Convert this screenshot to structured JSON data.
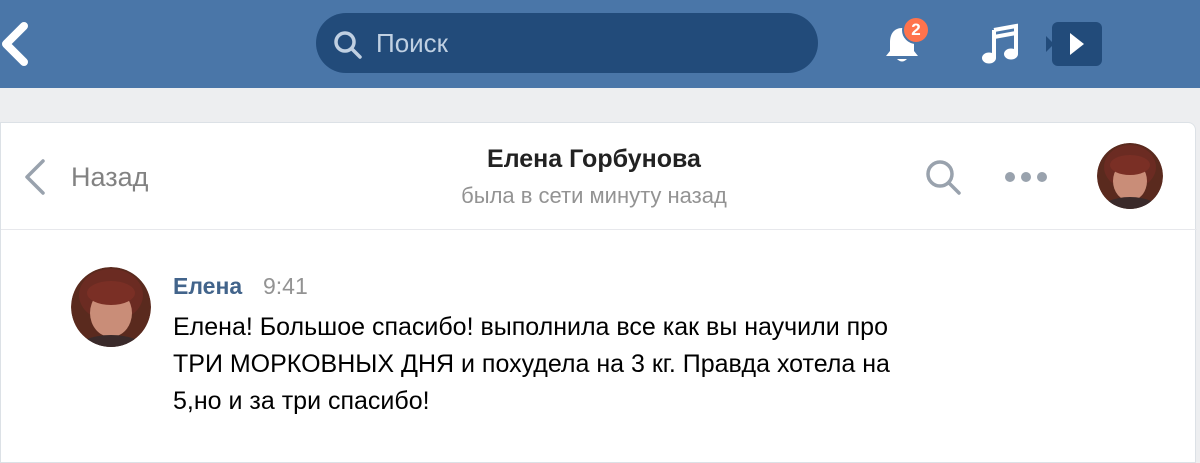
{
  "topbar": {
    "search_placeholder": "Поиск",
    "notifications_count": "2",
    "icons": [
      "vk-back-chevron-icon",
      "search-icon",
      "bell-icon",
      "music-note-icon",
      "video-player-icon"
    ]
  },
  "conversation": {
    "back_label": "Назад",
    "peer_name": "Елена Горбунова",
    "peer_status": "была в сети минуту назад"
  },
  "messages": [
    {
      "author": "Елена",
      "time": "9:41",
      "lines": [
        "Елена! Большое спасибо! выполнила все как вы научили про",
        "ТРИ МОРКОВНЫХ ДНЯ и похудела на 3 кг. Правда хотела на",
        "5,но и за три спасибо!"
      ]
    }
  ],
  "colors": {
    "topbar": "#4a76a8",
    "search_bg": "#224b7a",
    "badge": "#ff734c",
    "author": "#42648b",
    "muted": "#939393"
  }
}
